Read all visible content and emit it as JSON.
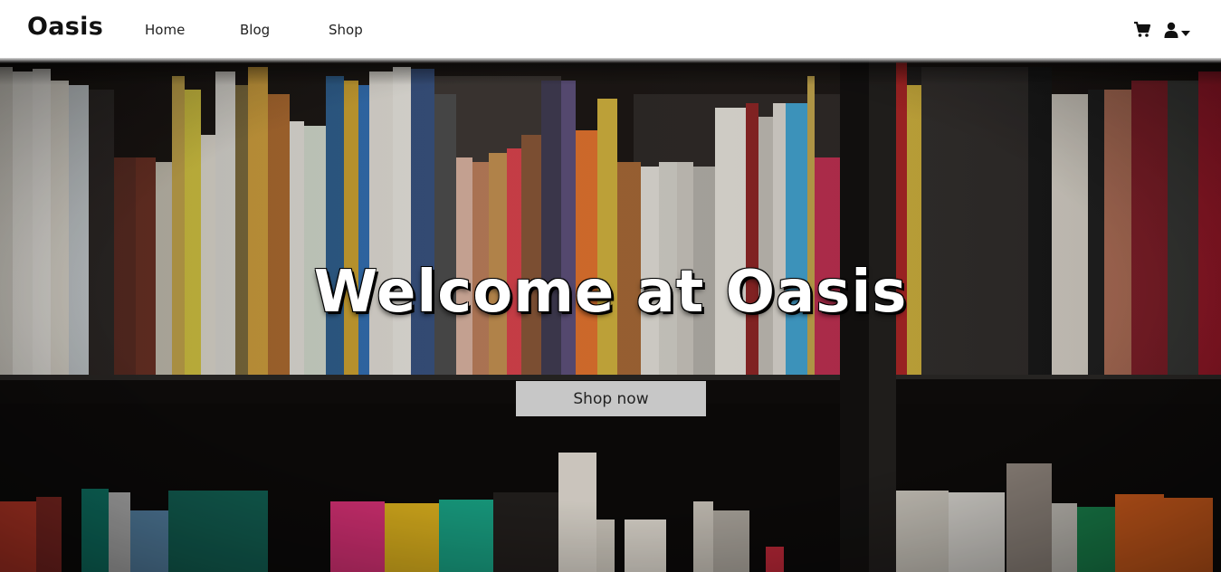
{
  "navbar": {
    "brand": "Oasis",
    "links": [
      {
        "label": "Home"
      },
      {
        "label": "Blog"
      },
      {
        "label": "Shop"
      }
    ],
    "icons": {
      "cart": "shopping-cart-icon",
      "user": "user-icon",
      "caret": "caret-down-icon"
    }
  },
  "hero": {
    "title": "Welcome at Oasis",
    "cta_label": "Shop now",
    "background": "bookshelf-photo"
  },
  "colors": {
    "cta_bg": "#c7c7c7",
    "title_text": "#ffffff",
    "navbar_bg": "#ffffff"
  }
}
